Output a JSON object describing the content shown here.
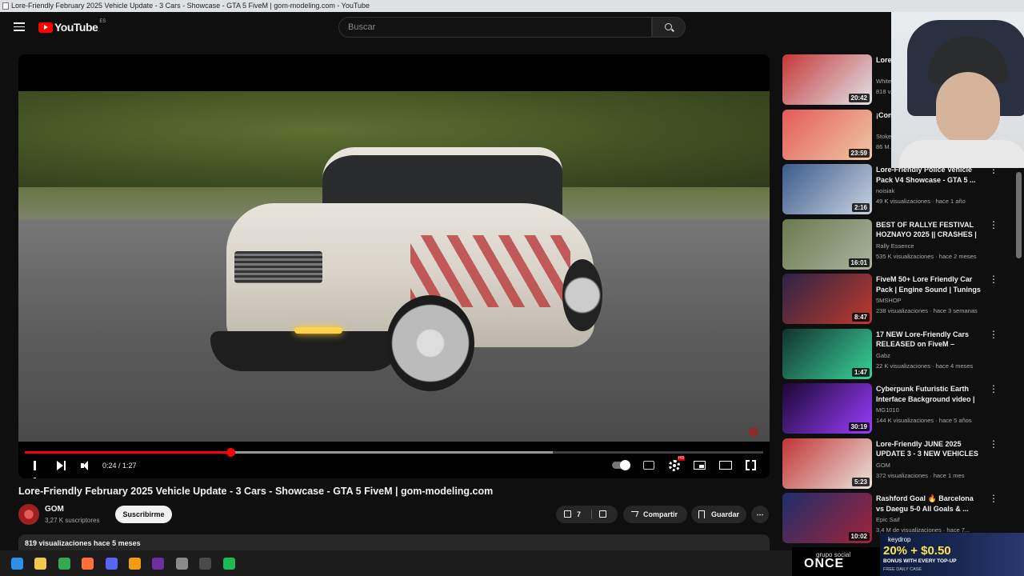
{
  "window": {
    "title": "Lore-Friendly February 2025 Vehicle Update - 3 Cars - Showcase - GTA 5 FiveM | gom-modeling.com - YouTube"
  },
  "header": {
    "logo_text": "YouTube",
    "country_code": "ES",
    "search_placeholder": "Buscar"
  },
  "player": {
    "time_display": "0:24 / 1:27",
    "progress_played": 0.278,
    "progress_buffered": 0.715,
    "quality_badge": "HD"
  },
  "video": {
    "title": "Lore-Friendly February 2025 Vehicle Update - 3 Cars - Showcase - GTA 5 FiveM | gom-modeling.com",
    "channel": "GOM",
    "subscribers": "3,27 K suscriptores",
    "subscribe_label": "Suscribirme",
    "likes": "7",
    "share_label": "Compartir",
    "save_label": "Guardar",
    "more_label": "⋯",
    "views_age": "819 visualizaciones  hace 5 meses"
  },
  "recommendations": [
    {
      "title": "Lore-Friendly Five...",
      "channel": "White...",
      "views": "818 v...",
      "duration": "20:42",
      "colors": [
        "#c73737",
        "#dfe4ea"
      ]
    },
    {
      "title": "¡Con... Debe...",
      "channel": "Stoke...",
      "views": "86 M...",
      "duration": "23:59",
      "colors": [
        "#e45a5a",
        "#f0c9a5"
      ]
    },
    {
      "title": "Lore-Friendly Police Vehicle Pack V4 Showcase - GTA 5 ...",
      "channel": "noisiak",
      "views": "49 K visualizaciones · hace 1 año",
      "duration": "2:16",
      "colors": [
        "#3b5b8c",
        "#c9d3e0"
      ]
    },
    {
      "title": "BEST OF RALLYE FESTIVAL HOZNAYO 2025 || CRASHES | ...",
      "channel": "Rally Essence",
      "views": "535 K visualizaciones · hace 2 meses",
      "duration": "16:01",
      "colors": [
        "#6a7a4d",
        "#aab3a0"
      ]
    },
    {
      "title": "FiveM 50+ Lore Friendly Car Pack | Engine Sound | Tunings ...",
      "channel": "5MSHOP",
      "views": "238 visualizaciones · hace 3 semanas",
      "duration": "8:47",
      "colors": [
        "#2a2446",
        "#c0392b"
      ]
    },
    {
      "title": "17 NEW Lore-Friendly Cars RELEASED on FiveM – SPRIN...",
      "channel": "Gabz",
      "views": "22 K visualizaciones · hace 4 meses",
      "duration": "1:47",
      "colors": [
        "#12322e",
        "#39d39a"
      ]
    },
    {
      "title": "Cyberpunk Futuristic Earth Interface Background video | ...",
      "channel": "MG1010",
      "views": "144 K visualizaciones · hace 5 años",
      "duration": "30:19",
      "colors": [
        "#1a0833",
        "#9b3cff"
      ]
    },
    {
      "title": "Lore-Friendly JUNE 2025 UPDATE 3 - 3 NEW VEHICLES ...",
      "channel": "GOM",
      "views": "372 visualizaciones · hace 1 mes",
      "duration": "5:23",
      "colors": [
        "#c23535",
        "#e9e4dc"
      ]
    },
    {
      "title": "Rashford Goal 🔥 Barcelona vs Daegu 5-0 All Goals & ...",
      "channel": "Epic Saif",
      "views": "3,4 M de visualizaciones · hace 7...",
      "duration": "10:02",
      "colors": [
        "#1d2f6b",
        "#a3223a"
      ]
    }
  ],
  "ads": {
    "once_small": "grupo social",
    "once_big": "ONCE",
    "keydrop_brand": "keydrop",
    "keydrop_offer": "20% + $0.50",
    "keydrop_bonus": "BONUS WITH EVERY TOP-UP",
    "keydrop_daily": "FREE DAILY CASE"
  },
  "taskbar": {
    "icons": [
      {
        "name": "windows-start-icon",
        "color": "#2f8fe8"
      },
      {
        "name": "file-explorer-icon",
        "color": "#f2c94c"
      },
      {
        "name": "chrome-icon",
        "color": "#34a853"
      },
      {
        "name": "firefox-icon",
        "color": "#ff7139"
      },
      {
        "name": "discord-icon",
        "color": "#5865f2"
      },
      {
        "name": "app-icon",
        "color": "#f39c12"
      },
      {
        "name": "next-app-icon",
        "color": "#6b2fa0"
      },
      {
        "name": "settings-icon",
        "color": "#8a8a8a"
      },
      {
        "name": "browser-app-icon",
        "color": "#4a4a4a"
      },
      {
        "name": "spotify-icon",
        "color": "#1db954"
      }
    ]
  }
}
